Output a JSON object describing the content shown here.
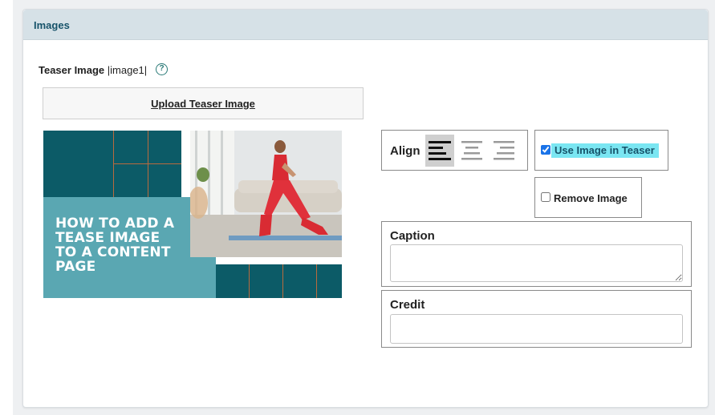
{
  "panel": {
    "title": "Images"
  },
  "field": {
    "label": "Teaser Image",
    "token": "|image1|",
    "help_icon": "help-circle-icon"
  },
  "upload": {
    "label": "Upload Teaser Image"
  },
  "teaser_image": {
    "text": "HOW TO ADD A TEASE IMAGE TO A CONTENT PAGE",
    "colors": {
      "dark_teal": "#0c5b67",
      "light_teal": "#5aa7b2",
      "accent_line": "#b96a3e"
    }
  },
  "align": {
    "label": "Align",
    "options": [
      {
        "name": "align-left-icon",
        "active": true
      },
      {
        "name": "align-center-icon",
        "active": false
      },
      {
        "name": "align-right-icon",
        "active": false
      }
    ]
  },
  "use_in_teaser": {
    "label": "Use Image in Teaser",
    "checked": true
  },
  "remove_image": {
    "label": "Remove Image",
    "checked": false
  },
  "caption": {
    "label": "Caption",
    "value": ""
  },
  "credit": {
    "label": "Credit",
    "value": ""
  }
}
